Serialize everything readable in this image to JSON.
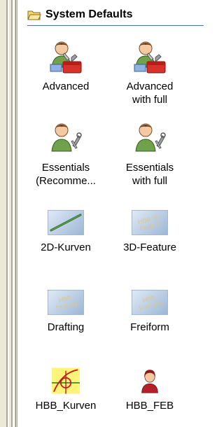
{
  "panel": {
    "title": "System Defaults",
    "icons": [
      {
        "label": "Advanced",
        "icon": "person-with-toolbox-icon"
      },
      {
        "label": "Advanced\nwith full",
        "icon": "person-with-toolbox-icon"
      },
      {
        "label": "Essentials\n(Recomme...",
        "icon": "person-with-tools-icon"
      },
      {
        "label": "Essentials\nwith full",
        "icon": "person-with-tools-icon"
      },
      {
        "label": "2D-Kurven",
        "icon": "2d-curve-thumbnail-icon"
      },
      {
        "label": "3D-Feature",
        "icon": "3d-feature-thumbnail-icon",
        "thumb_text": "HBB 3D\nFeature"
      },
      {
        "label": "Drafting",
        "icon": "drafting-thumbnail-icon",
        "thumb_text": "HBB\nDrafting"
      },
      {
        "label": "Freiform",
        "icon": "freeform-thumbnail-icon",
        "thumb_text": "HBB\nFreiform"
      },
      {
        "label": "HBB_Kurven",
        "icon": "curve-target-icon"
      },
      {
        "label": "HBB_FEB",
        "icon": "person-red-icon"
      }
    ]
  }
}
